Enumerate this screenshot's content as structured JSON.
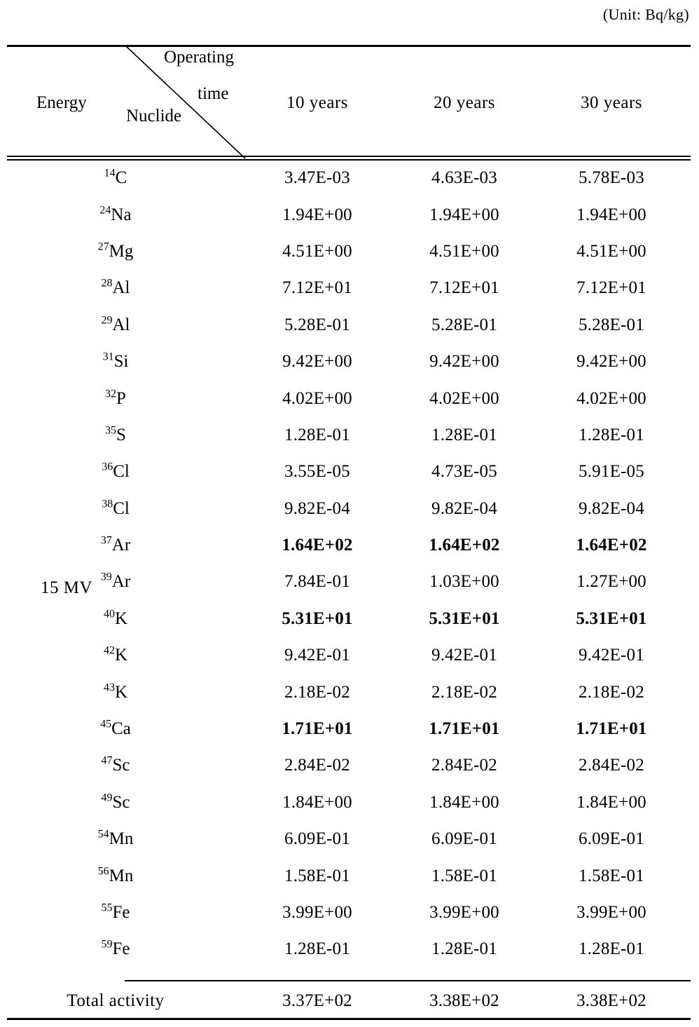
{
  "caption": {
    "unit_note": "(Unit: Bq/kg)"
  },
  "header": {
    "energy_label": "Energy",
    "corner_top_label_line1": "Operating",
    "corner_top_label_line2": "time",
    "corner_bottom_label": "Nuclide",
    "columns": [
      "10 years",
      "20 years",
      "30 years"
    ]
  },
  "energy_group": {
    "label": "15 MV"
  },
  "table": {
    "column_headers": [
      "Nuclide",
      "10 years",
      "20 years",
      "30 years"
    ],
    "rows": [
      {
        "mass": "14",
        "element": "C",
        "bold": false,
        "values": [
          "3.47E-03",
          "4.63E-03",
          "5.78E-03"
        ]
      },
      {
        "mass": "24",
        "element": "Na",
        "bold": false,
        "values": [
          "1.94E+00",
          "1.94E+00",
          "1.94E+00"
        ]
      },
      {
        "mass": "27",
        "element": "Mg",
        "bold": false,
        "values": [
          "4.51E+00",
          "4.51E+00",
          "4.51E+00"
        ]
      },
      {
        "mass": "28",
        "element": "Al",
        "bold": false,
        "values": [
          "7.12E+01",
          "7.12E+01",
          "7.12E+01"
        ]
      },
      {
        "mass": "29",
        "element": "Al",
        "bold": false,
        "values": [
          "5.28E-01",
          "5.28E-01",
          "5.28E-01"
        ]
      },
      {
        "mass": "31",
        "element": "Si",
        "bold": false,
        "values": [
          "9.42E+00",
          "9.42E+00",
          "9.42E+00"
        ]
      },
      {
        "mass": "32",
        "element": "P",
        "bold": false,
        "values": [
          "4.02E+00",
          "4.02E+00",
          "4.02E+00"
        ]
      },
      {
        "mass": "35",
        "element": "S",
        "bold": false,
        "values": [
          "1.28E-01",
          "1.28E-01",
          "1.28E-01"
        ]
      },
      {
        "mass": "36",
        "element": "Cl",
        "bold": false,
        "values": [
          "3.55E-05",
          "4.73E-05",
          "5.91E-05"
        ]
      },
      {
        "mass": "38",
        "element": "Cl",
        "bold": false,
        "values": [
          "9.82E-04",
          "9.82E-04",
          "9.82E-04"
        ]
      },
      {
        "mass": "37",
        "element": "Ar",
        "bold": true,
        "values": [
          "1.64E+02",
          "1.64E+02",
          "1.64E+02"
        ]
      },
      {
        "mass": "39",
        "element": "Ar",
        "bold": false,
        "values": [
          "7.84E-01",
          "1.03E+00",
          "1.27E+00"
        ]
      },
      {
        "mass": "40",
        "element": "K",
        "bold": true,
        "values": [
          "5.31E+01",
          "5.31E+01",
          "5.31E+01"
        ]
      },
      {
        "mass": "42",
        "element": "K",
        "bold": false,
        "values": [
          "9.42E-01",
          "9.42E-01",
          "9.42E-01"
        ]
      },
      {
        "mass": "43",
        "element": "K",
        "bold": false,
        "values": [
          "2.18E-02",
          "2.18E-02",
          "2.18E-02"
        ]
      },
      {
        "mass": "45",
        "element": "Ca",
        "bold": true,
        "values": [
          "1.71E+01",
          "1.71E+01",
          "1.71E+01"
        ]
      },
      {
        "mass": "47",
        "element": "Sc",
        "bold": false,
        "values": [
          "2.84E-02",
          "2.84E-02",
          "2.84E-02"
        ]
      },
      {
        "mass": "49",
        "element": "Sc",
        "bold": false,
        "values": [
          "1.84E+00",
          "1.84E+00",
          "1.84E+00"
        ]
      },
      {
        "mass": "54",
        "element": "Mn",
        "bold": false,
        "values": [
          "6.09E-01",
          "6.09E-01",
          "6.09E-01"
        ]
      },
      {
        "mass": "56",
        "element": "Mn",
        "bold": false,
        "values": [
          "1.58E-01",
          "1.58E-01",
          "1.58E-01"
        ]
      },
      {
        "mass": "55",
        "element": "Fe",
        "bold": false,
        "values": [
          "3.99E+00",
          "3.99E+00",
          "3.99E+00"
        ]
      },
      {
        "mass": "59",
        "element": "Fe",
        "bold": false,
        "values": [
          "1.28E-01",
          "1.28E-01",
          "1.28E-01"
        ]
      }
    ],
    "total": {
      "label": "Total activity",
      "values": [
        "3.37E+02",
        "3.38E+02",
        "3.38E+02"
      ]
    }
  }
}
